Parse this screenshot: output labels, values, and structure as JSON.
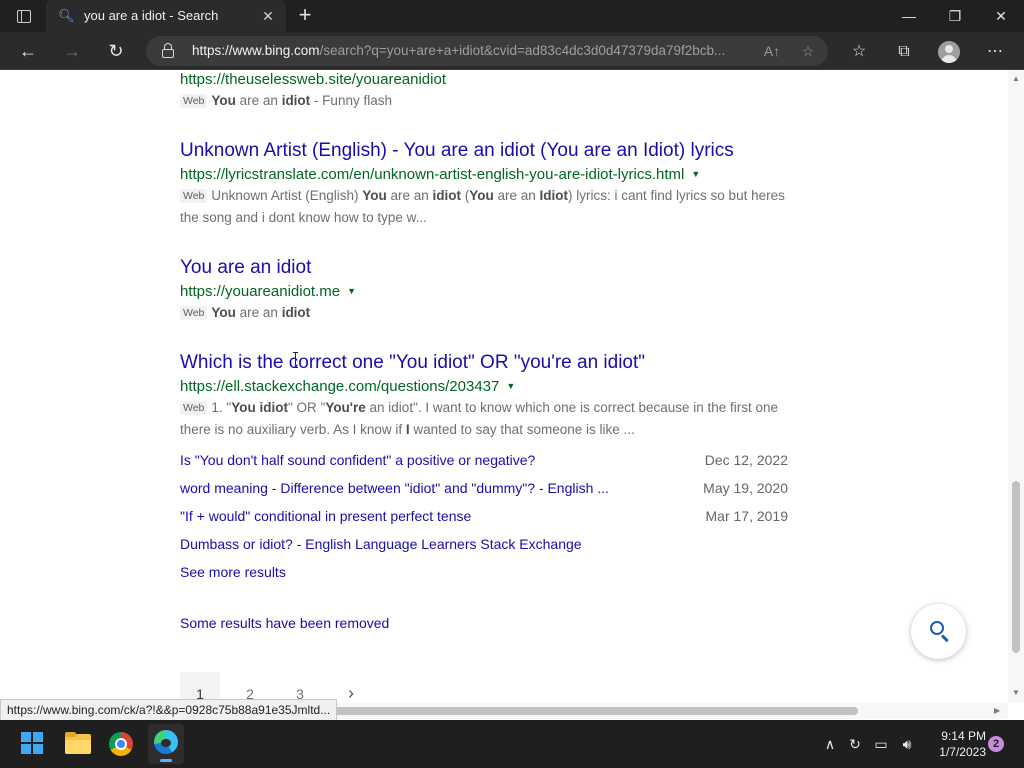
{
  "browser": {
    "tab_title": "you are a idiot - Search",
    "tab_close": "✕",
    "new_tab": "+",
    "url_host": "https://www.bing.com",
    "url_rest": "/search?q=you+are+a+idiot&cvid=ad83c4dc3d0d47379da79f2bcb...",
    "window_controls": {
      "minimize": "—",
      "restore": "❐",
      "close": "✕"
    },
    "icons": [
      "tab-actions-icon",
      "search-favicon-icon",
      "back-arrow-icon",
      "forward-arrow-icon",
      "refresh-icon",
      "lock-icon",
      "read-aloud-icon",
      "add-favorite-icon",
      "favorites-icon",
      "collections-icon",
      "profile-icon",
      "more-icon"
    ]
  },
  "results": {
    "top_url": "https://theuselessweb.site/youareanidiot",
    "top_tag": "Web",
    "top_snippet_b1": "You",
    "top_snippet_t1": " are an ",
    "top_snippet_b2": "idiot",
    "top_snippet_t2": " - Funny flash",
    "r1_title": "Unknown Artist (English) - You are an idiot (You are an Idiot) lyrics",
    "r1_url": "https://lyricstranslate.com/en/unknown-artist-english-you-are-idiot-lyrics.html",
    "r1_tag": "Web",
    "r1_t1": "Unknown Artist (English) ",
    "r1_b1": "You",
    "r1_t2": " are an ",
    "r1_b2": "idiot",
    "r1_t3": " (",
    "r1_b3": "You",
    "r1_t4": " are an ",
    "r1_b4": "Idiot",
    "r1_t5": ") lyrics: i cant find lyrics so but heres the song and i dont know how to type w...",
    "r2_title": "You are an idiot",
    "r2_url": "https://youareanidiot.me",
    "r2_tag": "Web",
    "r2_b1": "You",
    "r2_t1": " are an ",
    "r2_b2": "idiot",
    "r3_title": "Which is the correct one \"You idiot\" OR \"you're an idiot\"",
    "r3_url": "https://ell.stackexchange.com/questions/203437",
    "r3_tag": "Web",
    "r3_t1": "1. \"",
    "r3_b1": "You idiot",
    "r3_t2": "\" OR \"",
    "r3_b2": "You're",
    "r3_t3": " an idiot\". I want to know which one is correct because in the first one there is no auxiliary verb. As I know if ",
    "r3_b3": "I",
    "r3_t4": " wanted to say that someone is like ...",
    "deep_links": [
      {
        "text": "Is \"You don't half sound confident\" a positive or negative?",
        "date": "Dec 12, 2022"
      },
      {
        "text": "word meaning - Difference between \"idiot\" and \"dummy\"? - English ...",
        "date": "May 19, 2020"
      },
      {
        "text": "\"If + would\" conditional in present perfect tense",
        "date": "Mar 17, 2019"
      },
      {
        "text": "Dumbass or idiot? - English Language Learners Stack Exchange",
        "date": ""
      }
    ],
    "see_more": "See more results",
    "removed_notice": "Some results have been removed"
  },
  "pagination": {
    "pages": [
      "1",
      "2",
      "3"
    ],
    "current": "1",
    "next": "›"
  },
  "status_bar": "https://www.bing.com/ck/a?!&&p=0928c75b88a91e35Jmltd...",
  "taskbar": {
    "apps": [
      "windows-start",
      "file-explorer",
      "chrome",
      "edge"
    ],
    "time": "9:14 PM",
    "date": "1/7/2023",
    "notification_count": "2"
  }
}
